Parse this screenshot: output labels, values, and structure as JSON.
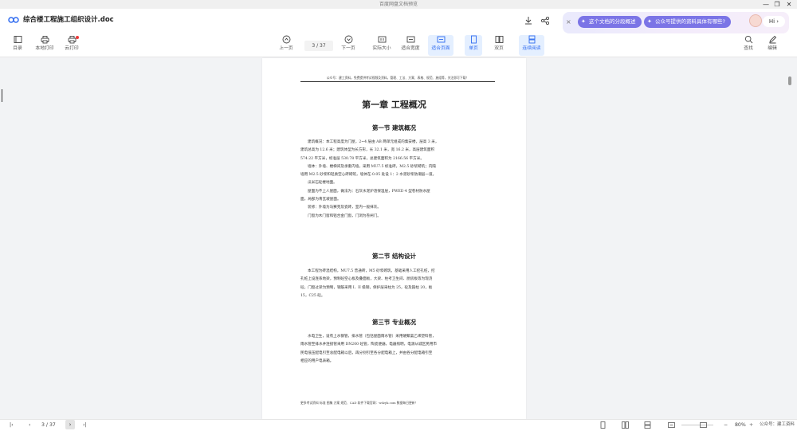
{
  "window": {
    "title": "百度网盘文档预览",
    "controls": [
      "—",
      "❐",
      "✕"
    ]
  },
  "app": {
    "doc_name": "综合楼工程施工组织设计.doc",
    "ai_close": "×",
    "ai_chips": [
      "这个文档的分段概述",
      "公众号提供的资料具体有哪些?"
    ],
    "hi_label": "Hi ›"
  },
  "toolbar": {
    "left": [
      "目录",
      "本地打印",
      "云打印"
    ],
    "prev_label": "上一页",
    "page_indicator": "3  /  37",
    "next_label": "下一页",
    "view_options": [
      "实际大小",
      "适合宽度",
      "适合页面",
      "单页",
      "双页",
      "连续阅读"
    ],
    "active_views": [
      "适合页面",
      "单页",
      "连续阅读"
    ],
    "right": [
      "查找",
      "编辑"
    ],
    "accent_color": "#2f6bf0"
  },
  "document": {
    "header_line": "公众号：建工资料，免费提供考试视频及资料，管理、工法、方案、表格、规范、施组等，关注即可下载！",
    "chapter_title": "第一章  工程概况",
    "sections": [
      {
        "title": "第一节  建筑概况",
        "lines": [
          {
            "indent": true,
            "text": "建筑概况：本工程高度为门屋，2~4 层由 AB 两单元组成的集安楼，层高 3 米，"
          },
          {
            "indent": false,
            "text": "建筑总高为 12.6 米；建筑体型为长方形，长 32.1 米，宽 16.2 米，高层建筑面积"
          },
          {
            "indent": false,
            "text": "574.22 平方米，标准层 530.78 平方米，总建筑面积为 2166.56 平方米。"
          },
          {
            "indent": true,
            "text": "墙体：外墙、楼梯间及承重内墙，采用 MU7.5 标准砖，M2.5 砂浆砌筑；内隔"
          },
          {
            "indent": false,
            "text": "墙用 M2.5 砂浆和轻质空心砖砌筑，墙体在-0.05 处设 1：2 水泥砂浆防潮层一道。"
          },
          {
            "indent": true,
            "text": "瓜米石砼楼地面。"
          },
          {
            "indent": true,
            "text": "屋面为不上人屋面，做法为：石灰水泥炉渣保温层，PWEE-4 型卷材防水屋"
          },
          {
            "indent": false,
            "text": "面，局部为青瓦坡屋面。"
          },
          {
            "indent": true,
            "text": "装修：外墙为马赛克及瓷砖，室内一般抹灰。"
          },
          {
            "indent": true,
            "text": "门窗为木门窗和铝合金门窗，门洞为卷闸门。"
          }
        ]
      },
      {
        "title": "第二节  结构设计",
        "lines": [
          {
            "indent": true,
            "text": "本工程为砖混结构，MU7.5 普通砖，M5 砂浆砌筑，基础采用人工挖孔桩，挖"
          },
          {
            "indent": false,
            "text": "孔桩上设连系地梁，预制砼空心板及叠面板，大梁、柱考卫生间、厨房板等为现浇"
          },
          {
            "indent": false,
            "text": "砼，门窗过梁为预制，钢筋采用 I、II 级钢，保护层采柱为 25，砼及箍柱 20，板"
          },
          {
            "indent": false,
            "text": "15，C25 砼。"
          }
        ]
      },
      {
        "title": "第三节  专业概况",
        "lines": [
          {
            "indent": true,
            "text": "水电卫生，设有上水钢管，排水管（包括屋面雨水管）采用硬聚氯乙烯塑料管，"
          },
          {
            "indent": false,
            "text": "雨水管至排水井连接管采用 DN200 砼管，陶瓷便器，电器照明，电源从城区民用市"
          },
          {
            "indent": false,
            "text": "民电低压配电引至总配电箱以后，再分别引至各分配电箱上，并由各分配电箱引至"
          },
          {
            "indent": false,
            "text": "相应的用户电表箱。"
          }
        ]
      }
    ],
    "footer_note": "更多考试资料  标准  图集  方案  规范、CAD 软件下载官网：wdzyk.com  数据每日更新！"
  },
  "statusbar": {
    "page_indicator": "3  /  37",
    "next_button": "›",
    "zoom": "80%",
    "watermark": "公众号：建工资料"
  }
}
